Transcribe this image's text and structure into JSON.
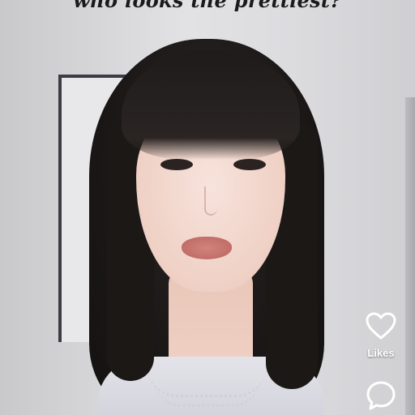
{
  "caption": {
    "text": "who looks the prettiest?"
  },
  "actions": {
    "like": {
      "label": "Likes",
      "icon": "heart-icon"
    },
    "comment": {
      "icon": "comment-icon"
    }
  },
  "colors": {
    "icon_color": "#ffffff",
    "caption_color": "#1a1a1a"
  }
}
